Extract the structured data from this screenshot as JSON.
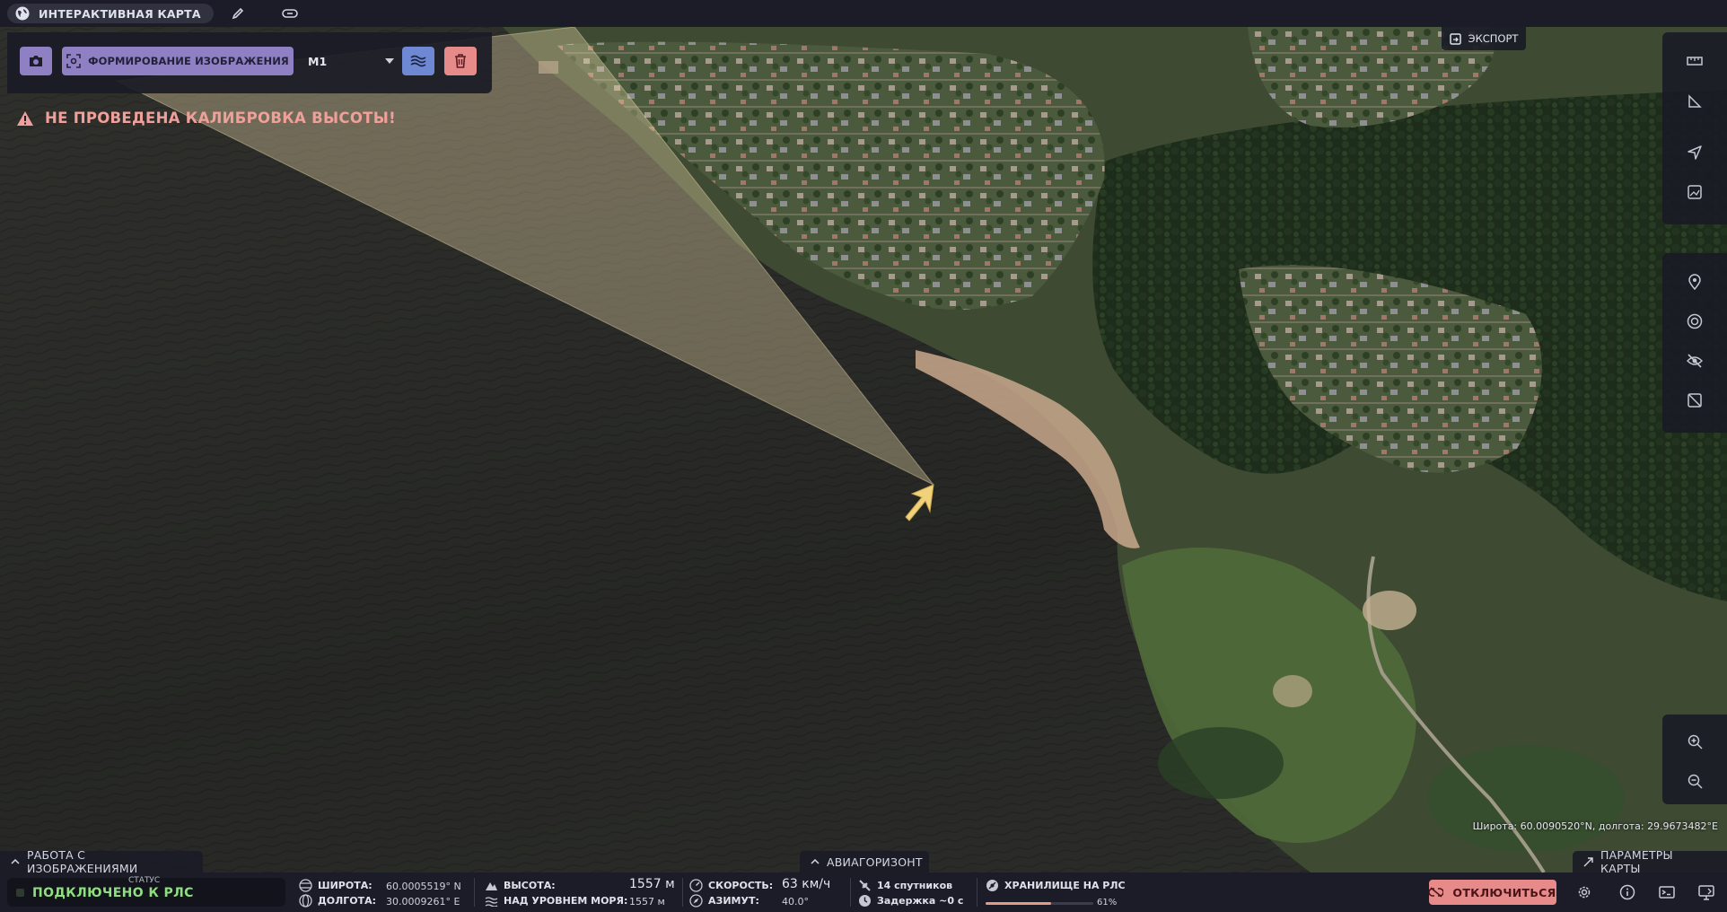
{
  "app": {
    "title": "ИНТЕРАКТИВНАЯ КАРТА",
    "icons": [
      "globe-icon",
      "pencil-icon",
      "link-icon"
    ]
  },
  "image_toolbar": {
    "form_image_label": "ФОРМИРОВАНИЕ ИЗОБРАЖЕНИЯ",
    "mode_value": "M1",
    "icons": [
      "camera-icon",
      "focus-icon",
      "chevron-down-icon",
      "waves-icon",
      "trash-icon"
    ]
  },
  "warning": {
    "text": "НЕ ПРОВЕДЕНА КАЛИБРОВКА ВЫСОТЫ!",
    "color": "#f0a09a"
  },
  "export": {
    "label": "ЭКСПОРТ"
  },
  "map": {
    "coord_readout": "Широта: 60.0090520°N, долгота: 29.9673482°E",
    "beam_color": "#e8d8a8",
    "aircraft_marker_color": "#f1d27a",
    "right_tools_top": [
      "ruler-icon",
      "angle-icon",
      "navigation-icon",
      "image-icon"
    ],
    "right_tools_middle": [
      "map-pin-icon",
      "target-icon",
      "visibility-off-icon",
      "image-off-icon"
    ],
    "zoom": [
      "zoom-in-icon",
      "zoom-out-icon"
    ]
  },
  "sections": {
    "imaging": "РАБОТА С ИЗОБРАЖЕНИЯМИ",
    "horizon": "АВИАГОРИЗОНТ",
    "map_params": "ПАРАМЕТРЫ КАРТЫ"
  },
  "status": {
    "caption": "СТАТУС",
    "value": "ПОДКЛЮЧЕНО К РЛС",
    "value_color": "#8ee07f"
  },
  "telemetry": {
    "lat_label": "ШИРОТА:",
    "lat_value": "60.0005519° N",
    "lon_label": "ДОЛГОТА:",
    "lon_value": "30.0009261° E",
    "alt_label": "ВЫСОТА:",
    "alt_value": "1557 м",
    "asl_label": "НАД УРОВНЕМ МОРЯ:",
    "asl_value": "1557 м",
    "speed_label": "СКОРОСТЬ:",
    "speed_value": "63 км/ч",
    "azimuth_label": "АЗИМУТ:",
    "azimuth_value": "40.0°",
    "satellites": "14 спутников",
    "delay": "Задержка ~0 с"
  },
  "storage": {
    "label": "ХРАНИЛИЩЕ НА РЛС",
    "percent_text": "61%",
    "fraction": 0.61,
    "bar_color": "#e59a86"
  },
  "actions": {
    "disconnect": "ОТКЛЮЧИТЬСЯ",
    "disconnect_color": "#e68a8a",
    "system_icons": [
      "gear-icon",
      "info-icon",
      "terminal-icon",
      "monitor-icon"
    ]
  }
}
